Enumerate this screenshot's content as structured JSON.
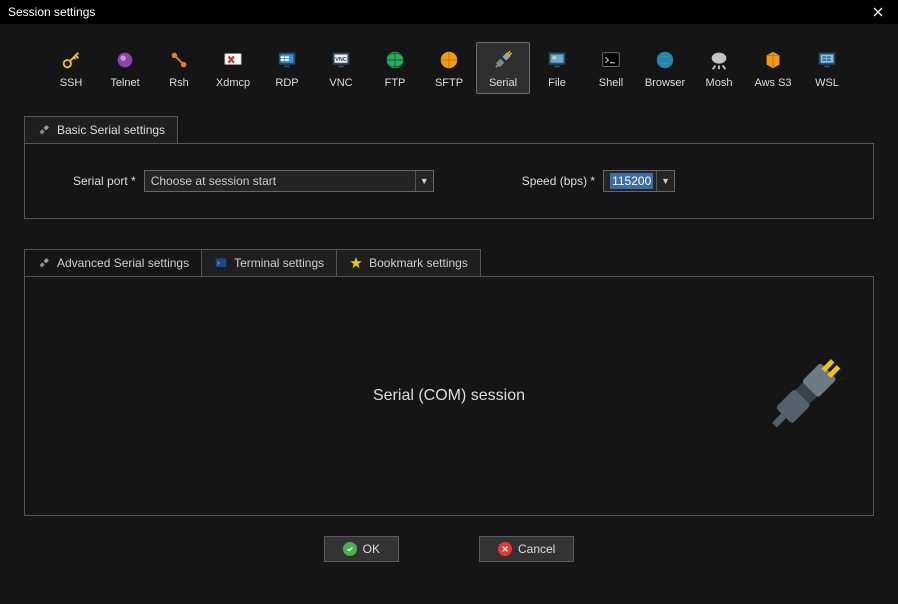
{
  "window": {
    "title": "Session settings"
  },
  "tools": [
    {
      "id": "ssh",
      "label": "SSH"
    },
    {
      "id": "telnet",
      "label": "Telnet"
    },
    {
      "id": "rsh",
      "label": "Rsh"
    },
    {
      "id": "xdmcp",
      "label": "Xdmcp"
    },
    {
      "id": "rdp",
      "label": "RDP"
    },
    {
      "id": "vnc",
      "label": "VNC"
    },
    {
      "id": "ftp",
      "label": "FTP"
    },
    {
      "id": "sftp",
      "label": "SFTP"
    },
    {
      "id": "serial",
      "label": "Serial"
    },
    {
      "id": "file",
      "label": "File"
    },
    {
      "id": "shell",
      "label": "Shell"
    },
    {
      "id": "browser",
      "label": "Browser"
    },
    {
      "id": "mosh",
      "label": "Mosh"
    },
    {
      "id": "awss3",
      "label": "Aws S3"
    },
    {
      "id": "wsl",
      "label": "WSL"
    }
  ],
  "selected_tool": "serial",
  "basic": {
    "tab_label": "Basic Serial settings",
    "port_label": "Serial port *",
    "port_value": "Choose at session start",
    "speed_label": "Speed (bps) *",
    "speed_value": "115200"
  },
  "tabs2": {
    "advanced": "Advanced Serial settings",
    "terminal": "Terminal settings",
    "bookmark": "Bookmark settings",
    "content_title": "Serial (COM) session"
  },
  "buttons": {
    "ok": "OK",
    "cancel": "Cancel"
  }
}
